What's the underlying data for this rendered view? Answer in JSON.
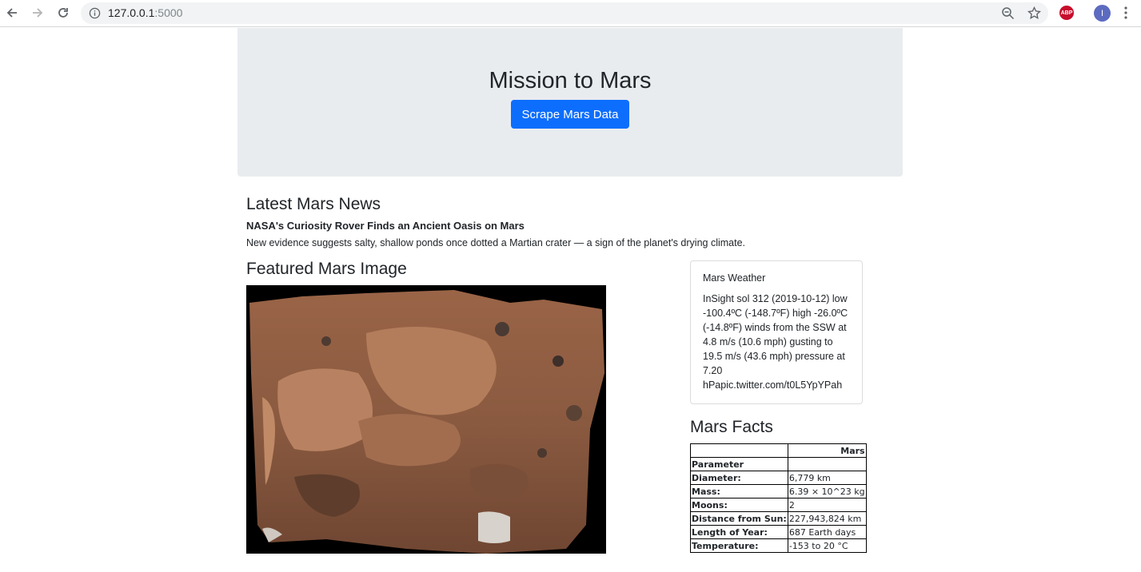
{
  "browser": {
    "url_host": "127.0.0.1",
    "url_port": ":5000",
    "profile_initial": "I",
    "adblock_label": "ABP"
  },
  "jumbotron": {
    "title": "Mission to Mars",
    "button_label": "Scrape Mars Data",
    "button_color": "#0d6efd",
    "background": "#e9ecef"
  },
  "news": {
    "heading": "Latest Mars News",
    "title": "NASA's Curiosity Rover Finds an Ancient Oasis on Mars",
    "paragraph": "New evidence suggests salty, shallow ponds once dotted a Martian crater — a sign of the planet's drying climate."
  },
  "featured": {
    "heading": "Featured Mars Image"
  },
  "weather": {
    "title": "Mars Weather",
    "text": "InSight sol 312 (2019-10-12) low -100.4ºC (-148.7ºF) high -26.0ºC (-14.8ºF) winds from the SSW at 4.8 m/s (10.6 mph) gusting to 19.5 m/s (43.6 mph) pressure at 7.20 hPapic.twitter.com/t0L5YpYPah"
  },
  "facts": {
    "heading": "Mars Facts",
    "column_header": "Mars",
    "index_header": "Parameter",
    "rows": [
      {
        "label": "Diameter:",
        "value": "6,779 km"
      },
      {
        "label": "Mass:",
        "value": "6.39 × 10^23 kg"
      },
      {
        "label": "Moons:",
        "value": "2"
      },
      {
        "label": "Distance from Sun:",
        "value": "227,943,824 km"
      },
      {
        "label": "Length of Year:",
        "value": "687 Earth days"
      },
      {
        "label": "Temperature:",
        "value": "-153 to 20 °C"
      }
    ]
  }
}
